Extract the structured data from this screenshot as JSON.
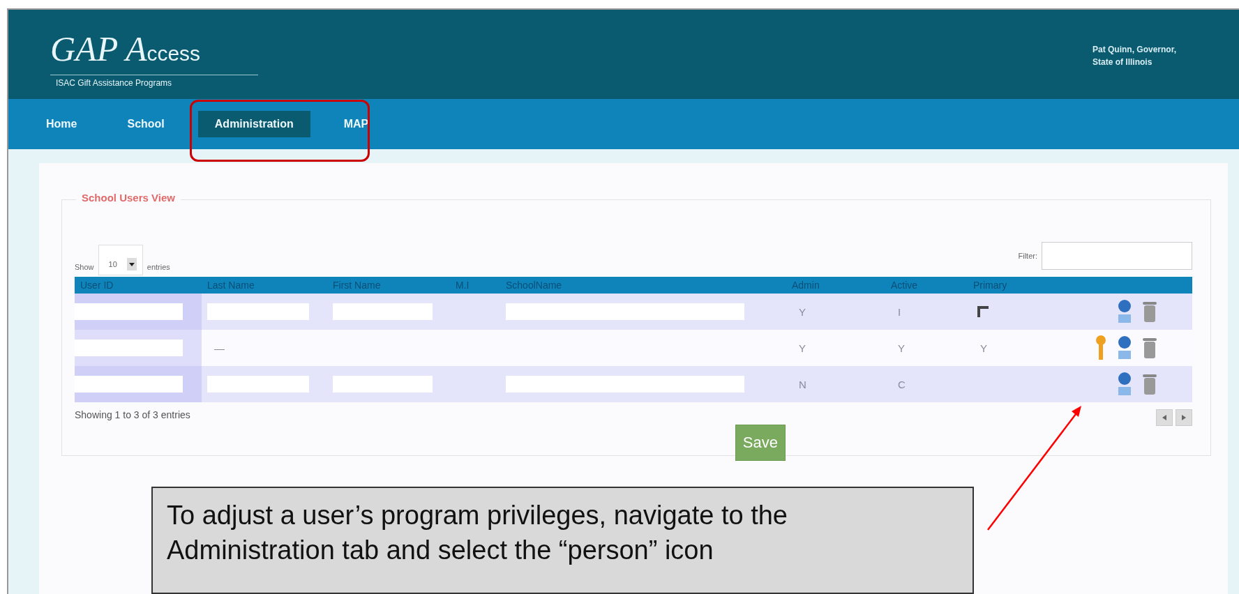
{
  "header": {
    "logo_title": "GAP A",
    "logo_title_small": "ccess",
    "logo_subtitle": "ISAC Gift Assistance Programs",
    "official_lines": [
      "Pat Quinn, Governor,",
      "State of Illinois"
    ]
  },
  "nav": [
    {
      "label": "Home",
      "selected": false
    },
    {
      "label": "School",
      "selected": false
    },
    {
      "label": "Administration",
      "selected": true
    },
    {
      "label": "MAP",
      "selected": false
    }
  ],
  "panel": {
    "legend": "School Users View",
    "show_label": "Show",
    "page_size": "10",
    "entries_label": "entries",
    "filter_label": "Filter:",
    "columns": [
      "User ID",
      "Last Name",
      "First Name",
      "M.I",
      "SchoolName",
      "Admin",
      "Active",
      "Primary"
    ],
    "rows": [
      {
        "cells": [
          {
            "kind": "redacted"
          },
          {
            "kind": "redacted"
          },
          {
            "kind": "redacted"
          },
          {
            "kind": "empty"
          },
          {
            "kind": "redacted"
          },
          {
            "kind": "text",
            "text": "Y"
          },
          {
            "kind": "text",
            "text": "I"
          },
          {
            "kind": "checkbox",
            "checked": false
          }
        ],
        "actions": [
          {
            "kind": "person"
          },
          {
            "kind": "trash"
          }
        ]
      },
      {
        "cells": [
          {
            "kind": "redacted"
          },
          {
            "kind": "text",
            "text": "—"
          },
          {
            "kind": "empty"
          },
          {
            "kind": "empty"
          },
          {
            "kind": "empty"
          },
          {
            "kind": "text",
            "text": "Y"
          },
          {
            "kind": "text",
            "text": "Y"
          },
          {
            "kind": "text",
            "text": "Y"
          }
        ],
        "actions": [
          {
            "kind": "key"
          },
          {
            "kind": "person"
          },
          {
            "kind": "trash"
          }
        ]
      },
      {
        "cells": [
          {
            "kind": "redacted"
          },
          {
            "kind": "redacted"
          },
          {
            "kind": "redacted"
          },
          {
            "kind": "empty"
          },
          {
            "kind": "redacted"
          },
          {
            "kind": "text",
            "text": "N"
          },
          {
            "kind": "text",
            "text": "C"
          },
          {
            "kind": "empty"
          }
        ],
        "actions": [
          {
            "kind": "person"
          },
          {
            "kind": "trash"
          }
        ]
      }
    ],
    "info": "Showing 1 to 3 of 3 entries",
    "save": "Save"
  },
  "callout": {
    "text": "To adjust a user’s program privileges, navigate to the Administration tab and select the “person” icon"
  }
}
